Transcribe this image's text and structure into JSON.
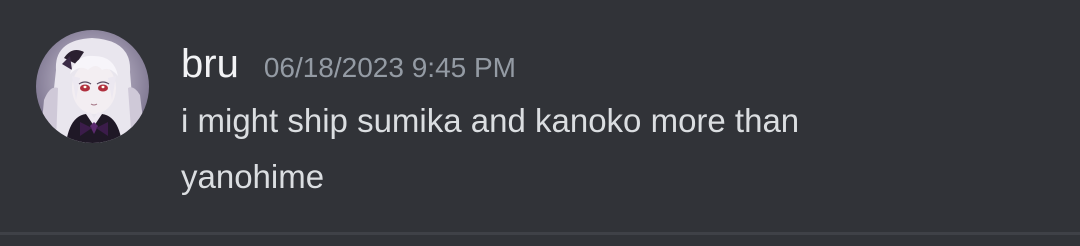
{
  "message": {
    "username": "bru",
    "timestamp": "06/18/2023 9:45 PM",
    "content_lines": [
      "i might ship sumika and kanoko more than",
      "yanohime"
    ]
  },
  "avatar": {
    "icon": "user-avatar-anime-character"
  },
  "colors": {
    "background": "#313338",
    "username": "#f2f3f5",
    "timestamp": "#949ba4",
    "content": "#dbdee1",
    "divider": "#3f4147"
  }
}
